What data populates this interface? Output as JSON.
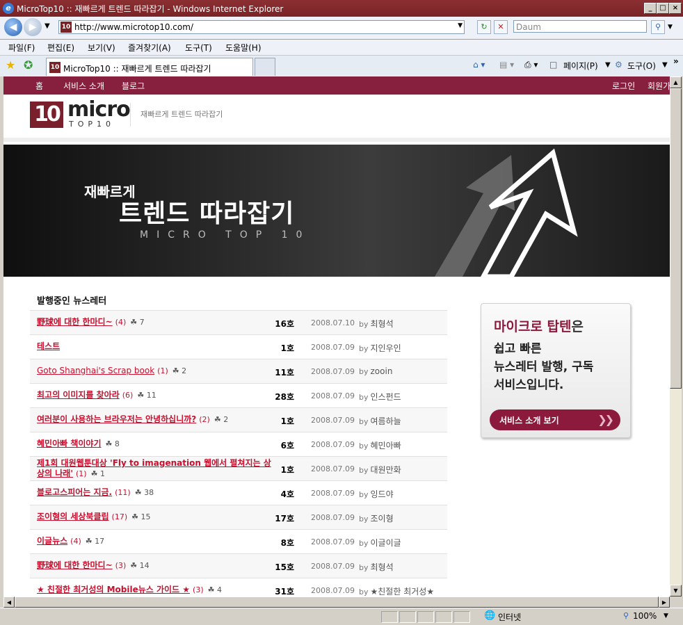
{
  "window": {
    "title": "MicroTop10 :: 재빠르게 트렌드 따라잡기 - Windows Internet Explorer",
    "controls": [
      "_",
      "□",
      "×"
    ]
  },
  "navbar": {
    "url": "http://www.microtop10.com/",
    "search_placeholder": "Daum"
  },
  "menubar": {
    "items": [
      "파일(F)",
      "편집(E)",
      "보기(V)",
      "즐겨찾기(A)",
      "도구(T)",
      "도움말(H)"
    ]
  },
  "tabs": {
    "active_title": "MicroTop10 :: 재빠르게 트렌드 따라잡기",
    "tools": {
      "page": "페이지(P)",
      "tools": "도구(O)"
    }
  },
  "site": {
    "nav": {
      "home": "홈",
      "service": "서비스 소개",
      "blog": "블로그",
      "login": "로그인",
      "join": "회원가"
    },
    "logo": {
      "ten": "10",
      "micro": "micro",
      "top": "TOP10"
    },
    "slogan": "재빠르게 트렌드 따라잡기",
    "banner": {
      "line1": "재빠르게",
      "line2": "트렌드 따라잡기",
      "line3": "MICRO TOP 10"
    },
    "newsletter_heading": "발행중인 뉴스레터",
    "promo": {
      "title": "마이크로 탑텐",
      "title_suffix": "은",
      "line1": "쉽고 빠른",
      "line2": "뉴스레터 발행, 구독",
      "line3": "서비스입니다.",
      "button": "서비스 소개 보기"
    }
  },
  "newsletters": [
    {
      "title": "野球에 대한 한마디~",
      "count": "(4)",
      "subs": "7",
      "issue": "16호",
      "date": "2008.07.10",
      "by": "by",
      "author": "최형석"
    },
    {
      "title": "테스트",
      "count": "",
      "subs": "",
      "issue": "1호",
      "date": "2008.07.09",
      "by": "by",
      "author": "지인우인"
    },
    {
      "title": "Goto Shanghai's Scrap book",
      "count": "(1)",
      "subs": "2",
      "issue": "11호",
      "date": "2008.07.09",
      "by": "by",
      "author": "zooin"
    },
    {
      "title": "최고의 이미지를 찾아라",
      "count": "(6)",
      "subs": "11",
      "issue": "28호",
      "date": "2008.07.09",
      "by": "by",
      "author": "인스펀드"
    },
    {
      "title": "여러분이 사용하는 브라우저는 안녕하십니까?",
      "count": "(2)",
      "subs": "2",
      "issue": "1호",
      "date": "2008.07.09",
      "by": "by",
      "author": "여름하늘"
    },
    {
      "title": "혜민아빠 책이야기",
      "count": "",
      "subs": "8",
      "issue": "6호",
      "date": "2008.07.09",
      "by": "by",
      "author": "혜민아빠"
    },
    {
      "title": "제1회 대원웹툰대상 'Fly to imagenation 웹에서 펼쳐지는 상상의 나래'",
      "count": "(1)",
      "subs": "1",
      "issue": "1호",
      "date": "2008.07.09",
      "by": "by",
      "author": "대원만화"
    },
    {
      "title": "블로고스피어는 지금.",
      "count": "(11)",
      "subs": "38",
      "issue": "4호",
      "date": "2008.07.09",
      "by": "by",
      "author": "잉드야"
    },
    {
      "title": "조이형의 세상북클립",
      "count": "(17)",
      "subs": "15",
      "issue": "17호",
      "date": "2008.07.09",
      "by": "by",
      "author": "조이형"
    },
    {
      "title": "이글뉴스",
      "count": "(4)",
      "subs": "17",
      "issue": "8호",
      "date": "2008.07.09",
      "by": "by",
      "author": "이글이글"
    },
    {
      "title": "野球에 대한 한마디~",
      "count": "(3)",
      "subs": "14",
      "issue": "15호",
      "date": "2008.07.09",
      "by": "by",
      "author": "최형석"
    },
    {
      "title": "★ 친절한 최거성의 Mobile뉴스 가이드 ★",
      "count": "(3)",
      "subs": "4",
      "issue": "31호",
      "date": "2008.07.09",
      "by": "by",
      "author": "★친절한 최거성★"
    }
  ],
  "status": {
    "zone": "인터넷",
    "zoom": "100%"
  }
}
